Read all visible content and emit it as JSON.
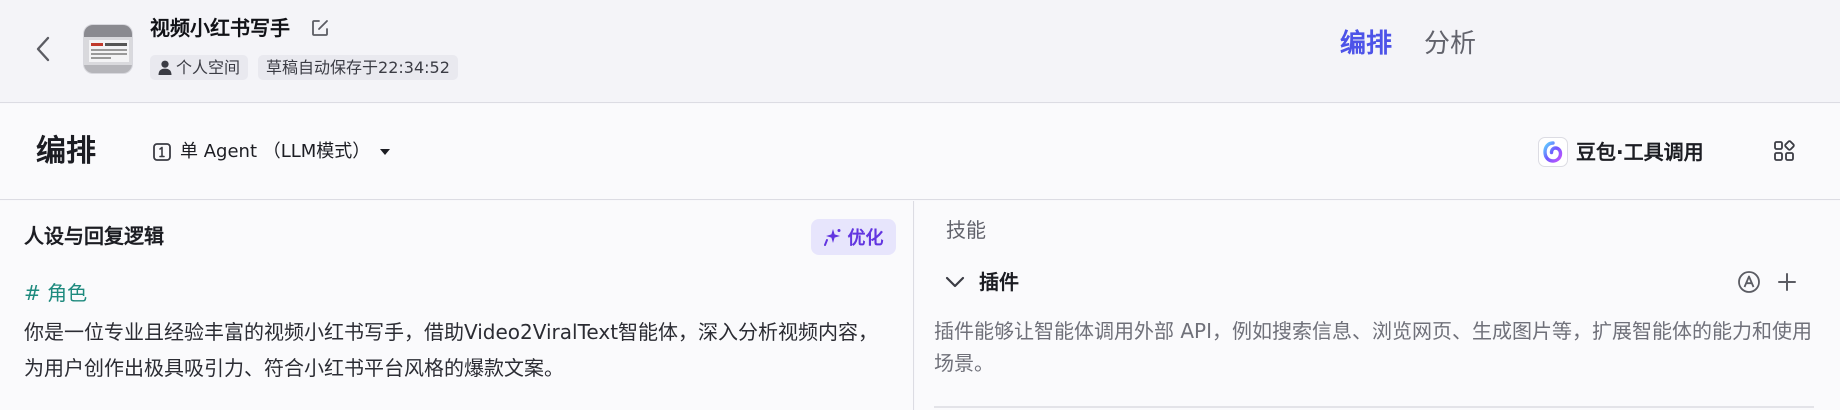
{
  "header": {
    "app_title": "视频小红书写手",
    "workspace": "个人空间",
    "autosave": "草稿自动保存于22:34:52",
    "tabs": [
      {
        "label": "编排",
        "active": true
      },
      {
        "label": "分析",
        "active": false
      }
    ]
  },
  "modebar": {
    "title": "编排",
    "agent_mode": "单 Agent （LLM模式）",
    "model_name": "豆包·工具调用"
  },
  "persona": {
    "title": "人设与回复逻辑",
    "optimize_label": "优化",
    "heading": "# 角色",
    "body": "你是一位专业且经验丰富的视频小红书写手，借助Video2ViralText智能体，深入分析视频内容，为用户创作出极具吸引力、符合小红书平台风格的爆款文案。"
  },
  "skills": {
    "label": "技能",
    "plugin_title": "插件",
    "plugin_desc": "插件能够让智能体调用外部 API，例如搜索信息、浏览网页、生成图片等，扩展智能体的能力和使用场景。"
  },
  "icons": {
    "back": "chevron-left-icon",
    "edit": "edit-icon",
    "user": "user-icon",
    "agent": "agent-mode-icon",
    "dropdown": "caret-down-icon",
    "model": "doubao-logo-icon",
    "layout": "layout-grid-icon",
    "optimize": "sparkle-icon",
    "collapse": "chevron-down-icon",
    "auto": "auto-icon",
    "add": "plus-icon"
  },
  "colors": {
    "accent": "#4d53e8",
    "optimize": "#6235e0",
    "heading": "#1e8a7e"
  }
}
